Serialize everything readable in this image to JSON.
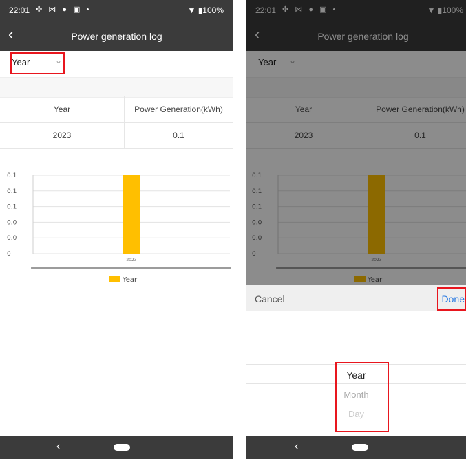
{
  "status": {
    "time": "22:01",
    "icons": "✣ ⋈ ● ▣ •",
    "battery": "▼ ▮100%"
  },
  "header": {
    "back_icon": "chevron-left-icon",
    "back": "‹",
    "title": "Power generation log"
  },
  "selector": {
    "value": "Year",
    "chevron": "⌄"
  },
  "table": {
    "headers": [
      "Year",
      "Power Generation(kWh)"
    ],
    "rows": [
      [
        "2023",
        "0.1"
      ]
    ]
  },
  "chart_data": {
    "type": "bar",
    "categories": [
      "2023"
    ],
    "series": [
      {
        "name": "Year",
        "values": [
          0.1
        ],
        "color": "#ffbf00"
      }
    ],
    "ytick_labels": [
      "0.1",
      "0.1",
      "0.1",
      "0.0",
      "0.0",
      "0"
    ],
    "ylim": [
      0,
      0.1
    ],
    "grid": true,
    "legend": "bottom-center"
  },
  "navbar": {
    "back": "‹"
  },
  "sheet": {
    "cancel": "Cancel",
    "done": "Done",
    "options": [
      "Year",
      "Month",
      "Day"
    ],
    "selected": "Year"
  },
  "colors": {
    "bar": "#ffbf00",
    "accent": "#2a7ae2",
    "highlight": "#e8161e",
    "topbar": "#3b3b3b"
  }
}
